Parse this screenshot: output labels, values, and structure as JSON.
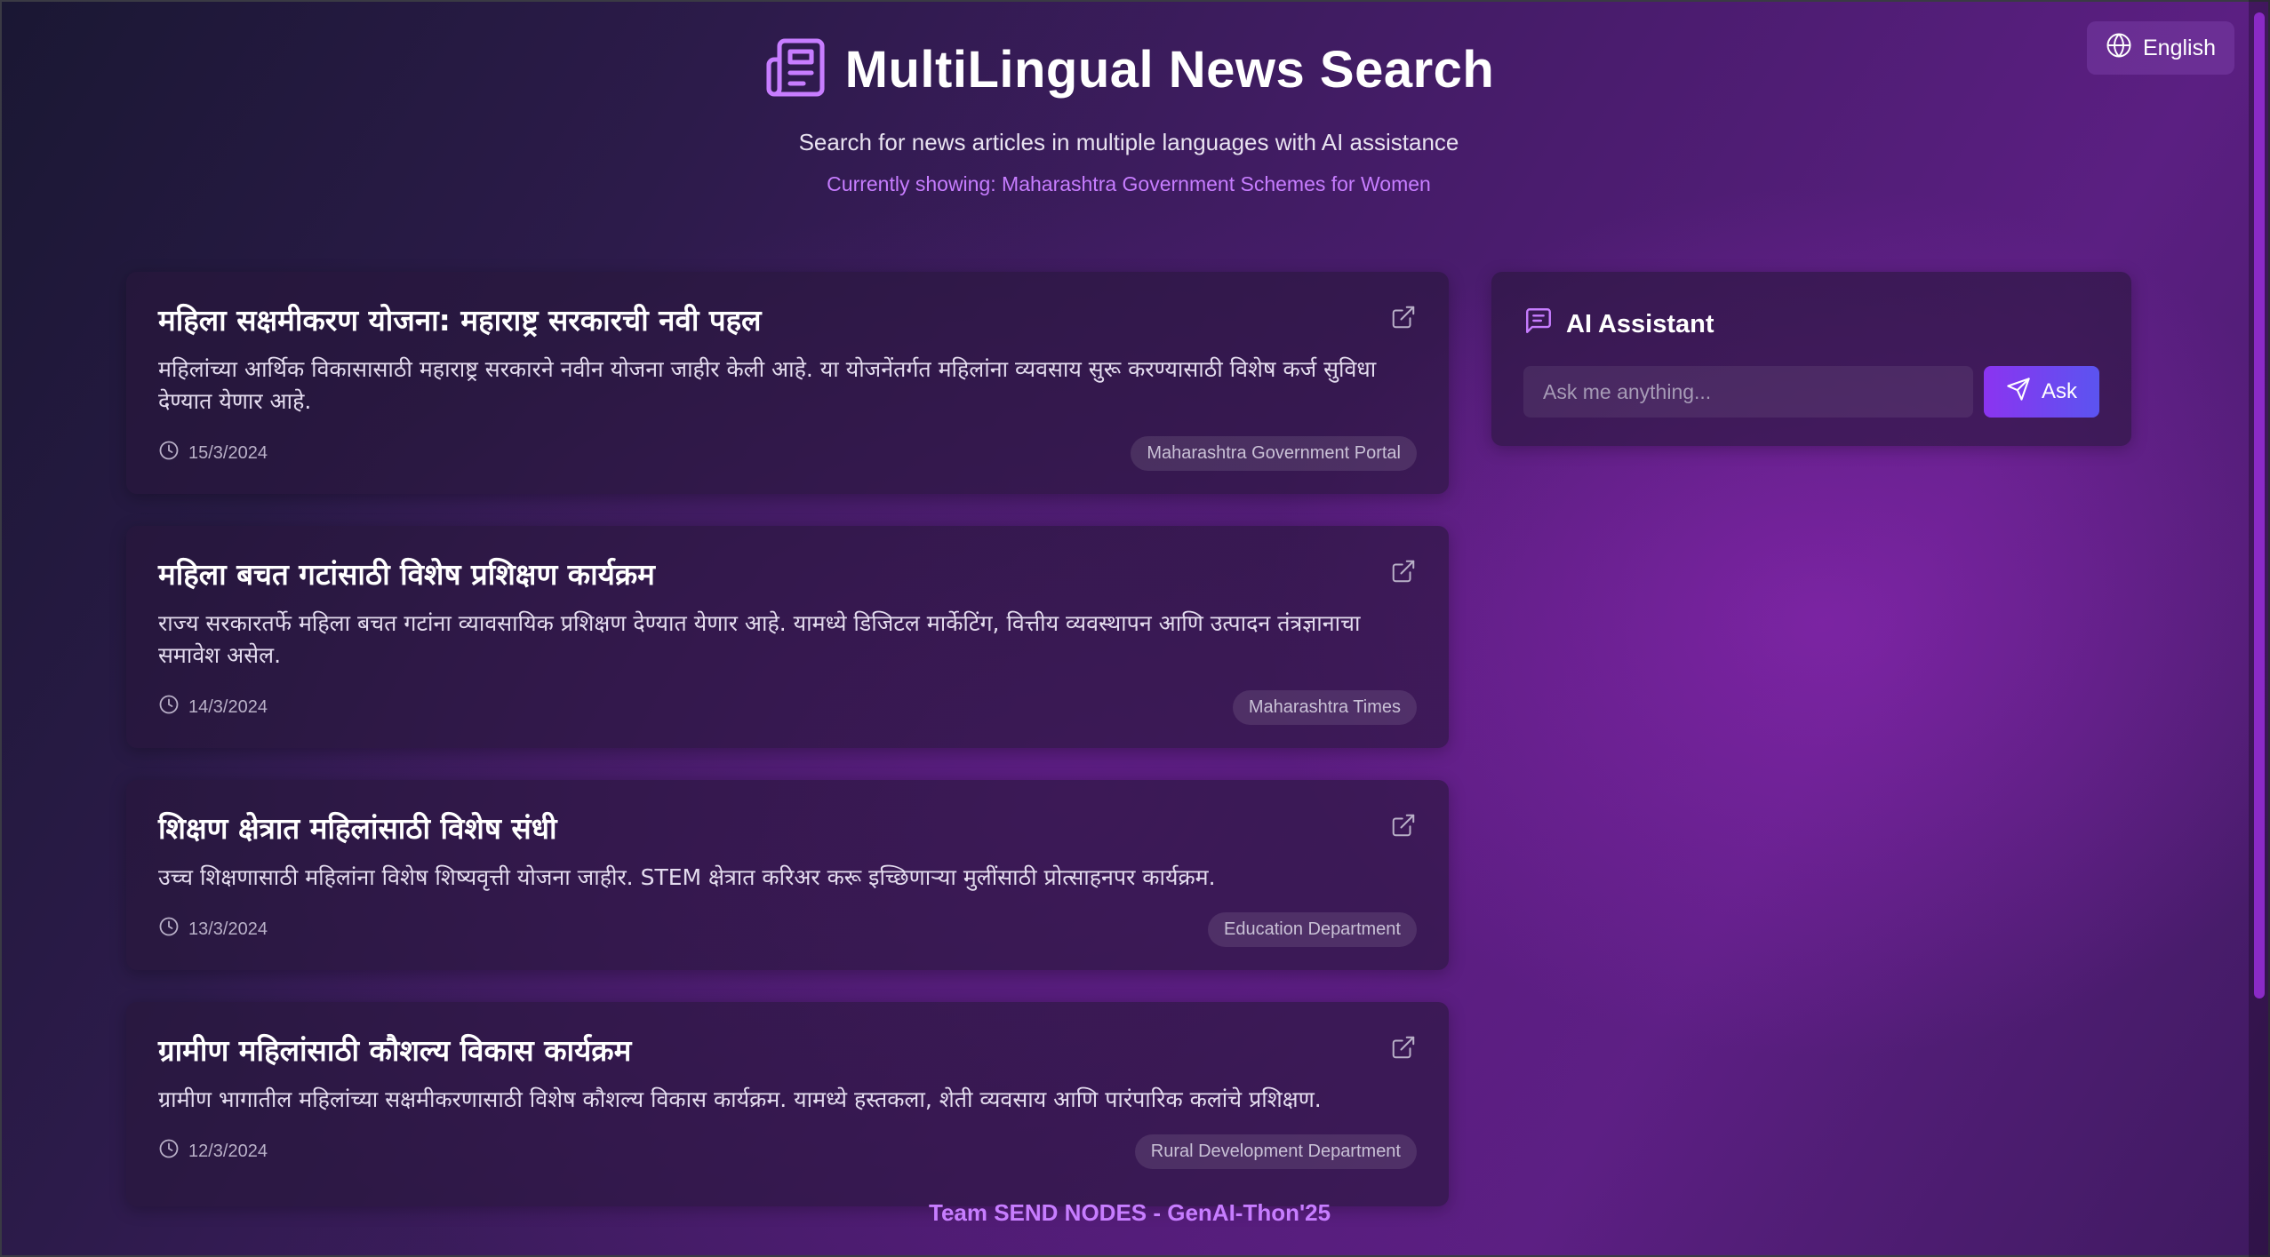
{
  "header": {
    "title": "MultiLingual News Search",
    "subtitle": "Search for news articles in multiple languages with AI assistance",
    "currently_showing": "Currently showing: Maharashtra Government Schemes for Women"
  },
  "language_button": {
    "label": "English",
    "icon": "globe-icon"
  },
  "articles": [
    {
      "title": "महिला सक्षमीकरण योजना: महाराष्ट्र सरकारची नवी पहल",
      "summary": "महिलांच्या आर्थिक विकासासाठी महाराष्ट्र सरकारने नवीन योजना जाहीर केली आहे. या योजनेंतर्गत महिलांना व्यवसाय सुरू करण्यासाठी विशेष कर्ज सुविधा देण्यात येणार आहे.",
      "date": "15/3/2024",
      "source": "Maharashtra Government Portal"
    },
    {
      "title": "महिला बचत गटांसाठी विशेष प्रशिक्षण कार्यक्रम",
      "summary": "राज्य सरकारतर्फे महिला बचत गटांना व्यावसायिक प्रशिक्षण देण्यात येणार आहे. यामध्ये डिजिटल मार्केटिंग, वित्तीय व्यवस्थापन आणि उत्पादन तंत्रज्ञानाचा समावेश असेल.",
      "date": "14/3/2024",
      "source": "Maharashtra Times"
    },
    {
      "title": "शिक्षण क्षेत्रात महिलांसाठी विशेष संधी",
      "summary": "उच्च शिक्षणासाठी महिलांना विशेष शिष्यवृत्ती योजना जाहीर. STEM क्षेत्रात करिअर करू इच्छिणाऱ्या मुलींसाठी प्रोत्साहनपर कार्यक्रम.",
      "date": "13/3/2024",
      "source": "Education Department"
    },
    {
      "title": "ग्रामीण महिलांसाठी कौशल्य विकास कार्यक्रम",
      "summary": "ग्रामीण भागातील महिलांच्या सक्षमीकरणासाठी विशेष कौशल्य विकास कार्यक्रम. यामध्ये हस्तकला, शेती व्यवसाय आणि पारंपारिक कलांचे प्रशिक्षण.",
      "date": "12/3/2024",
      "source": "Rural Development Department"
    }
  ],
  "assistant": {
    "title": "AI Assistant",
    "input_placeholder": "Ask me anything...",
    "ask_label": "Ask"
  },
  "footer": {
    "team": "Team SEND NODES - GenAI-Thon'25"
  },
  "colors": {
    "accent": "#c77dff",
    "button_gradient_start": "#8b34f0",
    "button_gradient_end": "#5b54f0"
  }
}
